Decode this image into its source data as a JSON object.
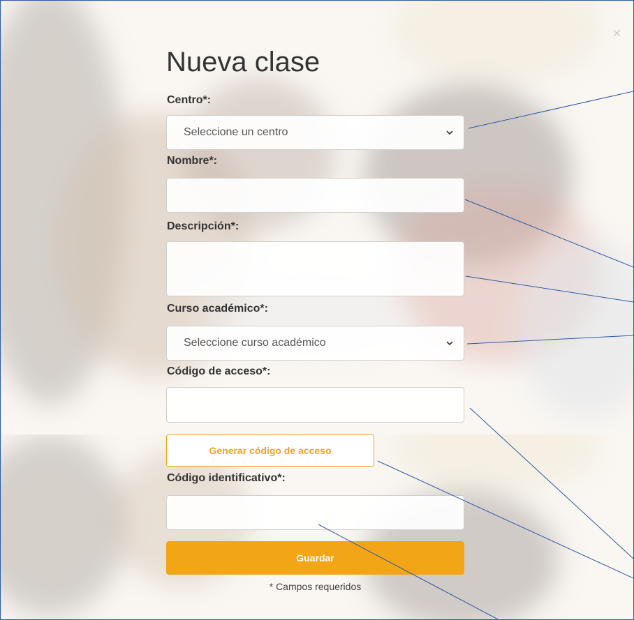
{
  "form": {
    "title": "Nueva clase",
    "close_symbol": "×",
    "centro": {
      "label": "Centro*:",
      "selected": "Seleccione un centro"
    },
    "nombre": {
      "label": "Nombre*:",
      "value": ""
    },
    "descripcion": {
      "label": "Descripción*:",
      "value": ""
    },
    "curso": {
      "label": "Curso académico*:",
      "selected": "Seleccione curso académico"
    },
    "codigo_acceso": {
      "label": "Código de acceso*:",
      "value": ""
    },
    "generar_button": "Generar código de acceso",
    "codigo_identificativo": {
      "label": "Código identificativo*:",
      "value": ""
    },
    "guardar_button": "Guardar",
    "required_note": "* Campos requeridos"
  },
  "colors": {
    "accent": "#f2a516",
    "frame_border": "#2b5aa6",
    "callout_lines": "#2b5aa6"
  },
  "icons": {
    "close": "close-icon",
    "select_arrow": "chevron-down-icon"
  }
}
